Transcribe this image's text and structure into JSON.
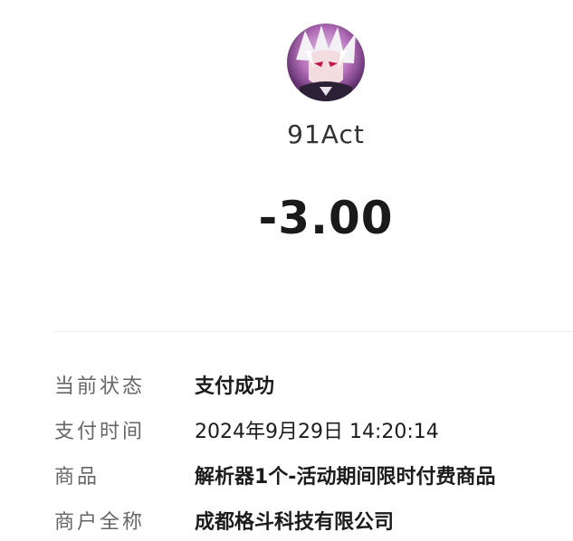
{
  "merchant": {
    "avatar_icon": "anime-character-avatar-icon",
    "name": "91Act"
  },
  "amount": "-3.00",
  "details": {
    "status_label": "当前状态",
    "status_value": "支付成功",
    "time_label": "支付时间",
    "time_value": "2024年9月29日 14:20:14",
    "product_label": "商品",
    "product_value": "解析器1个-活动期间限时付费商品",
    "merchant_label": "商户全称",
    "merchant_value": "成都格斗科技有限公司"
  },
  "colors": {
    "background": "#ffffff",
    "label": "#666666",
    "value": "#1c1c1c",
    "divider": "#ececec"
  }
}
